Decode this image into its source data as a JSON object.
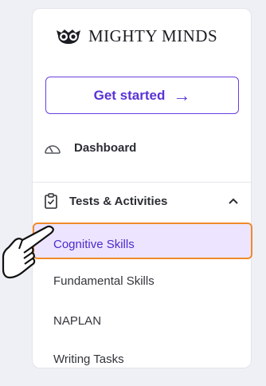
{
  "brand": {
    "name": "MIGHTY MINDS",
    "logo_icon": "owl-icon"
  },
  "cta": {
    "label": "Get started",
    "arrow": "→"
  },
  "nav": {
    "dashboard": {
      "label": "Dashboard",
      "icon": "gauge-icon"
    },
    "tests": {
      "label": "Tests & Activities",
      "icon": "clipboard-icon",
      "expanded": true
    },
    "sub_items": [
      {
        "label": "Cognitive Skills",
        "selected": true
      },
      {
        "label": "Fundamental Skills"
      },
      {
        "label": "NAPLAN"
      },
      {
        "label": "Writing Tasks"
      }
    ]
  },
  "colors": {
    "accent": "#6a3fe0",
    "highlight_bg": "#ede5ff",
    "highlight_border": "#f08a2c"
  }
}
